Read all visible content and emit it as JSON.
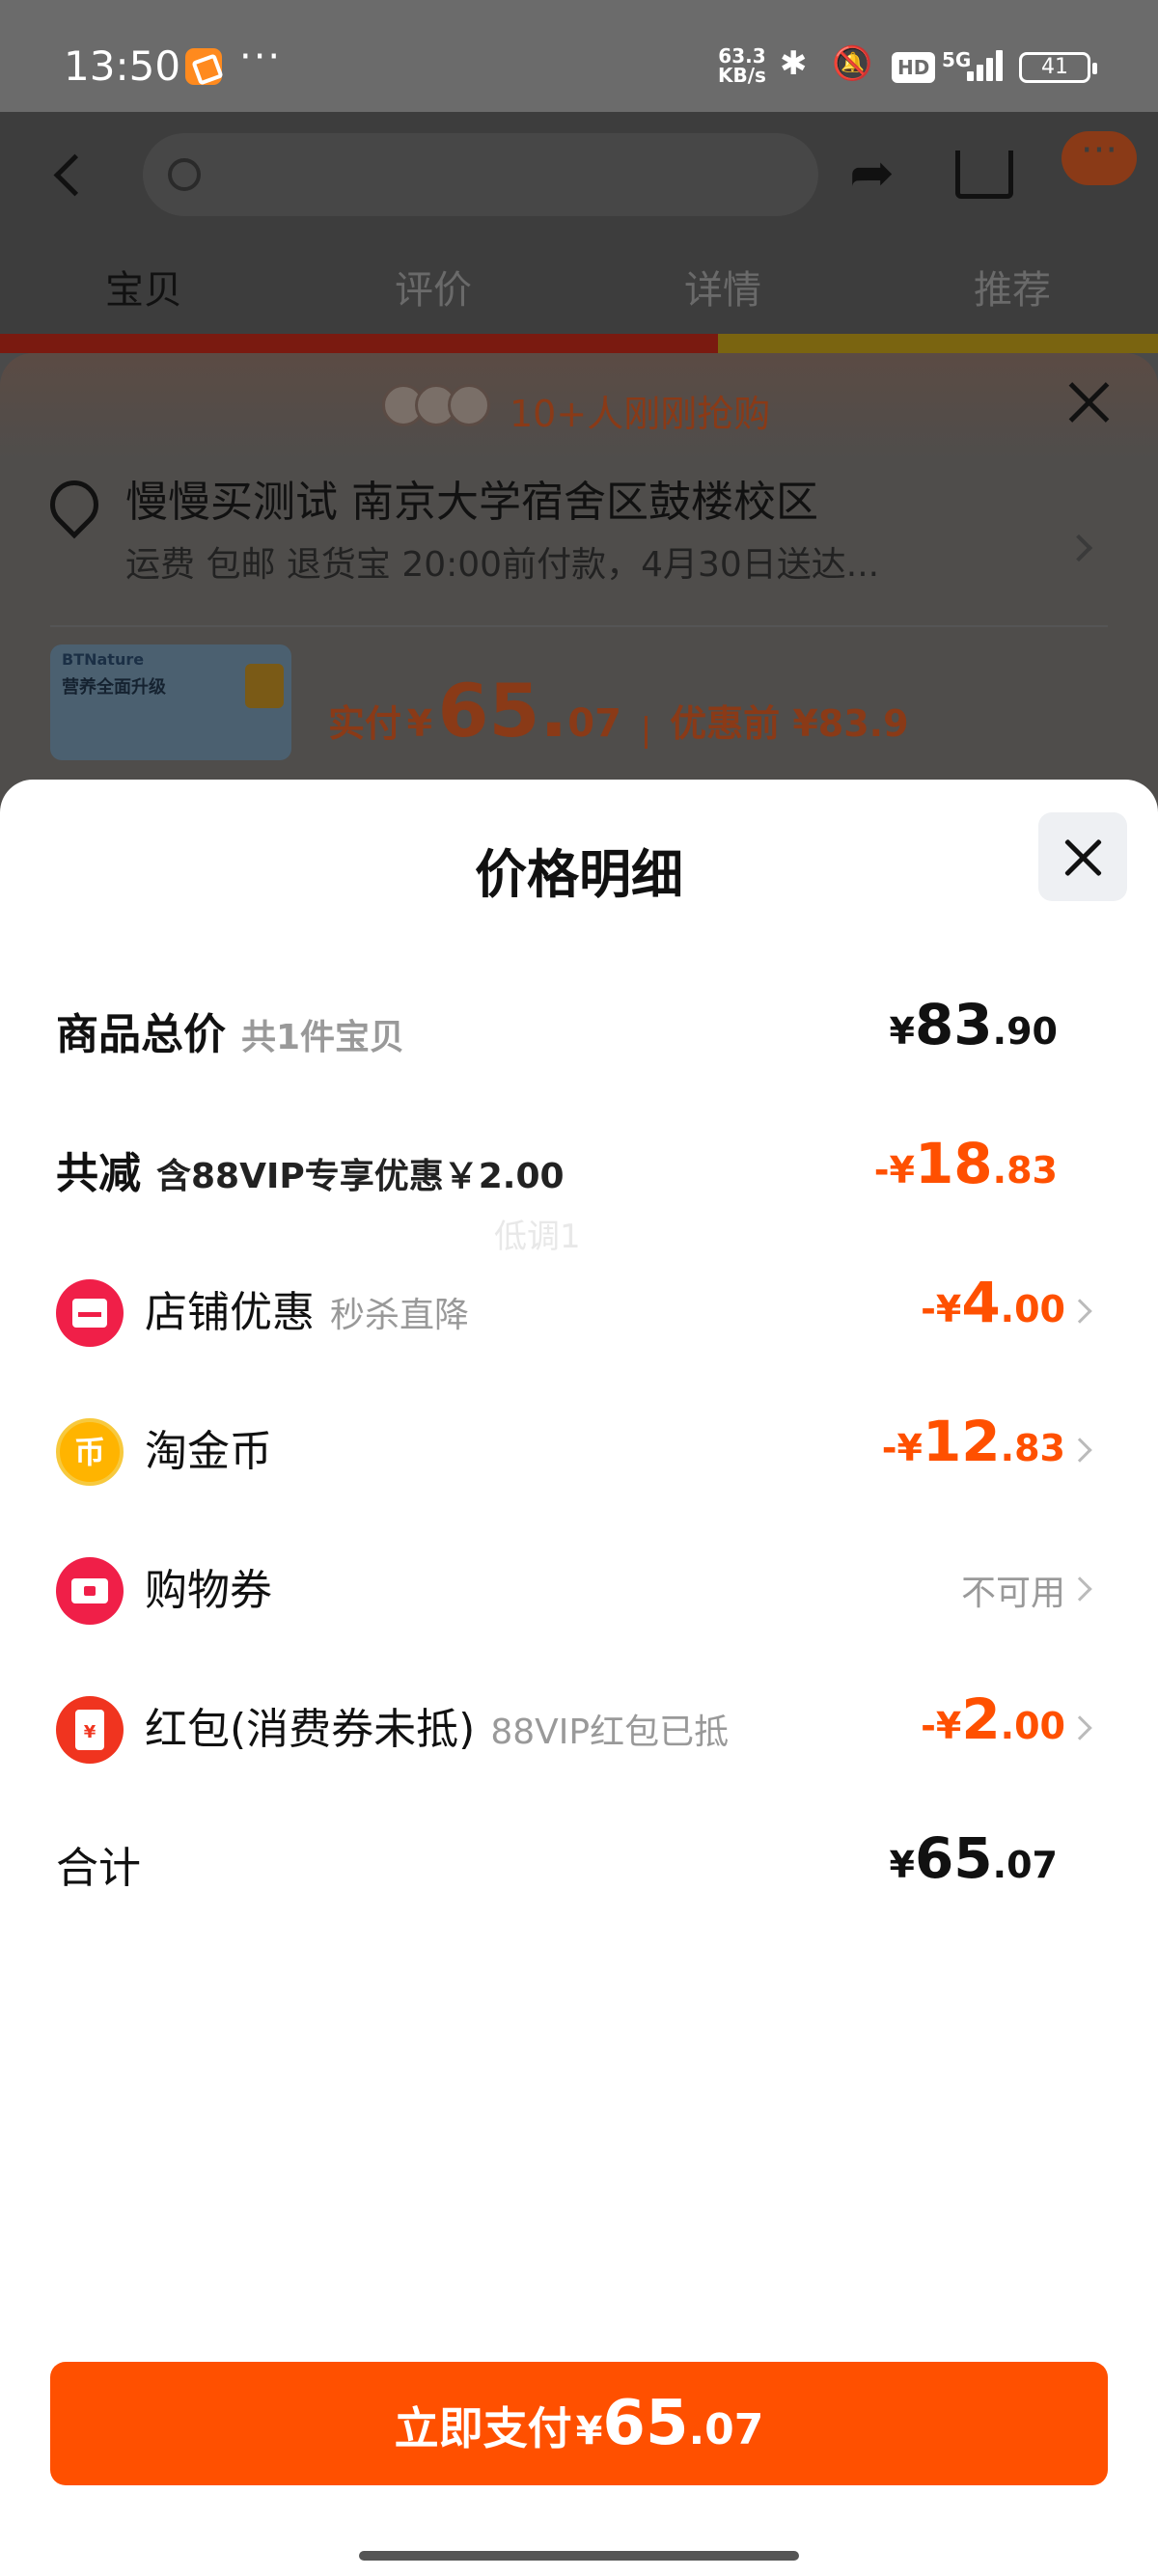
{
  "status_bar": {
    "time": "13:50",
    "more": "···",
    "speed_top": "63.3",
    "speed_bottom": "KB/s",
    "hd": "HD",
    "network": "5G",
    "battery": "41"
  },
  "background_page": {
    "tabs": [
      {
        "label": "宝贝",
        "active": true
      },
      {
        "label": "评价",
        "active": false
      },
      {
        "label": "详情",
        "active": false
      },
      {
        "label": "推荐",
        "active": false
      }
    ],
    "snap_text": "10+人刚刚抢购",
    "address": "慢慢买测试 南京大学宿舍区鼓楼校区",
    "shipping": "运费 包邮 退货宝 20:00前付款，4月30日送达...",
    "thumb_brand": "BTNature",
    "thumb_tagline": "营养全面升级",
    "pay_label": "实付",
    "pay_currency": "¥",
    "pay_int": "65.",
    "pay_dec": "07",
    "before_discount": "优惠前 ¥83.9"
  },
  "modal": {
    "title": "价格明细",
    "watermark": "低调1",
    "rows": {
      "total": {
        "label": "商品总价",
        "sub": "共1件宝贝",
        "cur": "¥",
        "int": "83",
        "dec": ".90"
      },
      "reduce": {
        "label": "共减",
        "sub": "含88VIP专享优惠￥2.00",
        "cur": "-¥",
        "int": "18",
        "dec": ".83"
      },
      "shop": {
        "icon": "shop-icon",
        "label": "店铺优惠",
        "sub": "秒杀直降",
        "cur": "-¥",
        "int": "4",
        "dec": ".00"
      },
      "coin": {
        "icon": "coin-icon",
        "label": "淘金币",
        "sub": "",
        "cur": "-¥",
        "int": "12",
        "dec": ".83"
      },
      "voucher": {
        "icon": "voucher-icon",
        "label": "购物券",
        "sub": "",
        "status": "不可用"
      },
      "redpacket": {
        "icon": "red-packet-icon",
        "label": "红包(消费券未抵)",
        "sub": "88VIP红包已抵",
        "cur": "-¥",
        "int": "2",
        "dec": ".00"
      },
      "sum": {
        "label": "合计",
        "cur": "¥",
        "int": "65",
        "dec": ".07"
      }
    },
    "coin_glyph": "币",
    "packet_glyph": "¥",
    "pay_button": {
      "text": "立即支付",
      "cur": "¥",
      "int": "65",
      "dec": ".07"
    }
  },
  "colors": {
    "accent": "#ff5000",
    "icon_red": "#f01f48",
    "coin_gold": "#ffb400"
  }
}
